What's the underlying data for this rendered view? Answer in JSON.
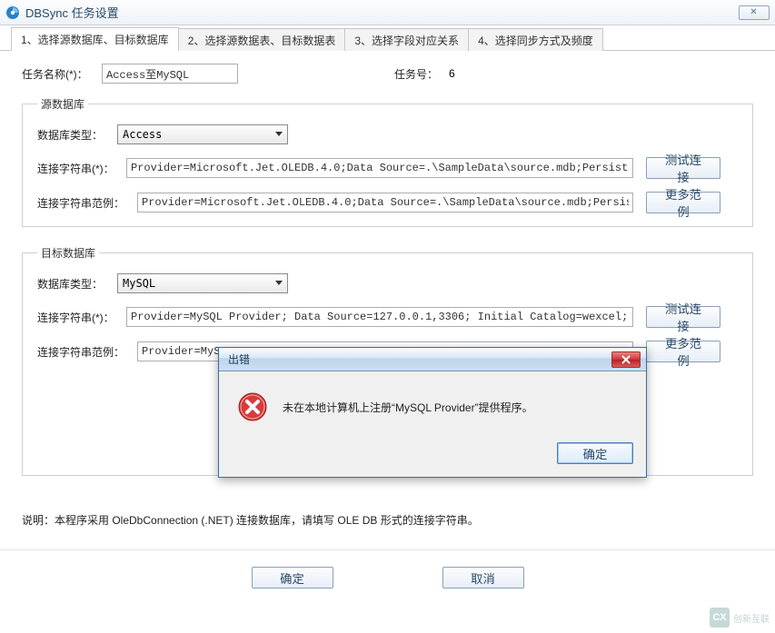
{
  "window": {
    "title": "DBSync 任务设置",
    "close_glyph": "✕"
  },
  "tabs": [
    {
      "label": "1、选择源数据库、目标数据库"
    },
    {
      "label": "2、选择源数据表、目标数据表"
    },
    {
      "label": "3、选择字段对应关系"
    },
    {
      "label": "4、选择同步方式及频度"
    }
  ],
  "task": {
    "name_label": "任务名称(*)：",
    "name_value": "Access至MySQL",
    "id_label": "任务号：",
    "id_value": "6"
  },
  "source": {
    "legend": "源数据库",
    "type_label": "数据库类型：",
    "type_value": "Access",
    "conn_label": "连接字符串(*)：",
    "conn_value": "Provider=Microsoft.Jet.OLEDB.4.0;Data Source=.\\SampleData\\source.mdb;Persist Security Info=Fa",
    "test_btn": "测试连接",
    "sample_label": "连接字符串范例：",
    "sample_value": "Provider=Microsoft.Jet.OLEDB.4.0;Data Source=.\\SampleData\\source.mdb;Persist Security Info=Fa",
    "more_btn": "更多范例"
  },
  "target": {
    "legend": "目标数据库",
    "type_label": "数据库类型：",
    "type_value": "MySQL",
    "conn_label": "连接字符串(*)：",
    "conn_value": "Provider=MySQL Provider; Data Source=127.0.0.1,3306; Initial Catalog=wexcel;User Id=root;Pass",
    "test_btn": "测试连接",
    "sample_label": "连接字符串范例：",
    "sample_value": "Provider=MySQL",
    "more_btn": "更多范例"
  },
  "note": "说明：本程序采用 OleDbConnection (.NET) 连接数据库，请填写 OLE DB 形式的连接字符串。",
  "buttons": {
    "ok": "确定",
    "cancel": "取消"
  },
  "error_dialog": {
    "title": "出错",
    "message": "未在本地计算机上注册“MySQL Provider”提供程序。",
    "ok": "确定"
  },
  "watermark": {
    "logo": "CX",
    "text": "创新互联"
  }
}
